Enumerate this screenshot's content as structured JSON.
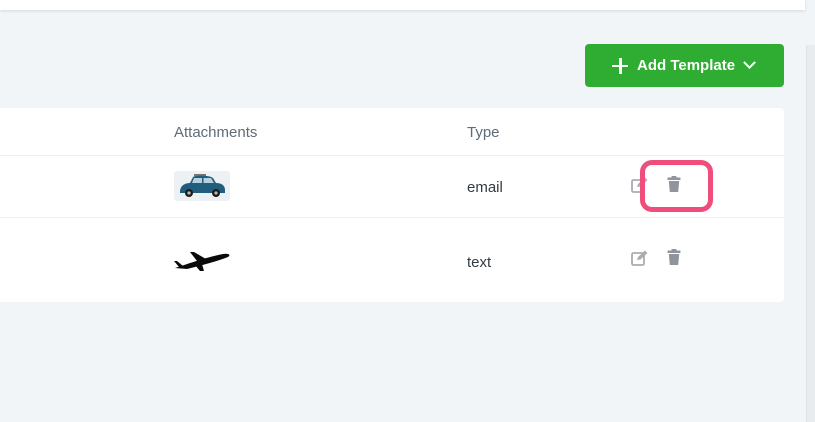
{
  "toolbar": {
    "add_template_label": "Add Template",
    "accent_color": "#2fad32"
  },
  "table": {
    "headers": [
      "Attachments",
      "Type"
    ],
    "rows": [
      {
        "attachment_icon": "blue-car-thumbnail",
        "type": "email",
        "actions": [
          "edit-icon",
          "trash-icon"
        ]
      },
      {
        "attachment_icon": "airplane-silhouette",
        "type": "text",
        "actions": [
          "edit-icon",
          "trash-icon"
        ]
      }
    ]
  },
  "highlight": {
    "color": "#ef4d7b",
    "target": "row-1-delete-icon"
  }
}
